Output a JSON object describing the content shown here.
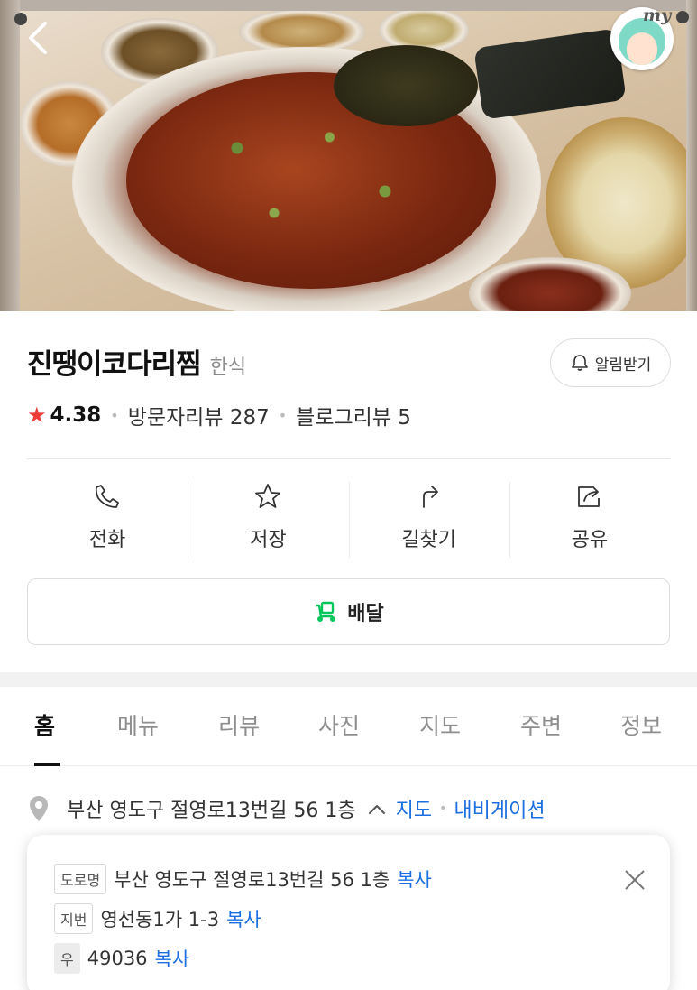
{
  "header": {
    "avatar_text": "my"
  },
  "place": {
    "name": "진땡이코다리찜",
    "category": "한식",
    "alarm_label": "알림받기"
  },
  "rating": {
    "score": "4.38",
    "visitor_reviews": "방문자리뷰 287",
    "blog_reviews": "블로그리뷰 5"
  },
  "actions": [
    {
      "label": "전화",
      "icon": "phone-icon"
    },
    {
      "label": "저장",
      "icon": "star-icon"
    },
    {
      "label": "길찾기",
      "icon": "directions-icon"
    },
    {
      "label": "공유",
      "icon": "share-icon"
    }
  ],
  "delivery": {
    "label": "배달",
    "icon_color": "#03c75a"
  },
  "tabs": [
    "홈",
    "메뉴",
    "리뷰",
    "사진",
    "지도",
    "주변",
    "정보"
  ],
  "address": {
    "text": "부산 영도구 절영로13번길 56 1층",
    "map_link": "지도",
    "navi_link": "내비게이션",
    "popup": {
      "road_tag": "도로명",
      "road_value": "부산 영도구 절영로13번길 56 1층",
      "lot_tag": "지번",
      "lot_value": "영선동1가 1-3",
      "zip_tag": "우",
      "zip_value": "49036",
      "copy_label": "복사"
    }
  },
  "colors": {
    "accent_link": "#1b6fe0",
    "rating_star": "#ef3a3a",
    "brand_green": "#03c75a"
  }
}
